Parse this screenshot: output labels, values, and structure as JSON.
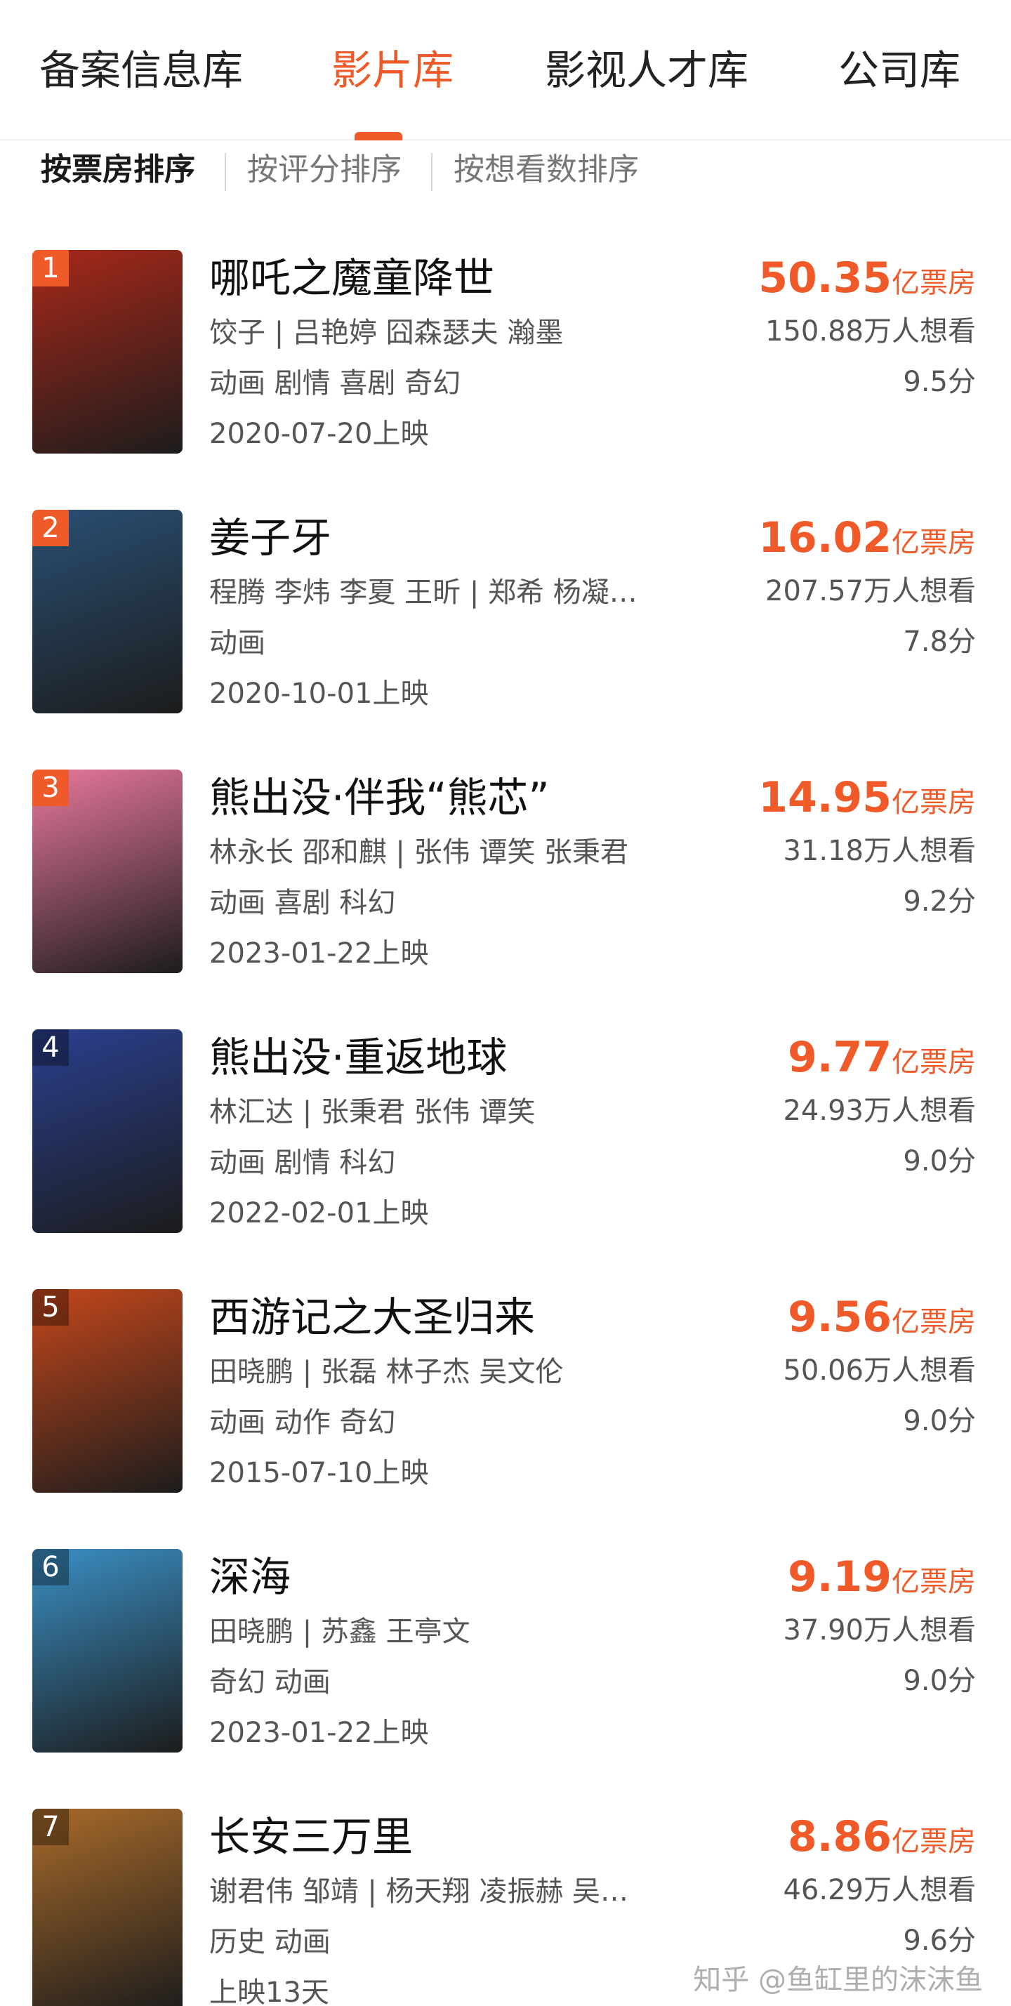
{
  "tabs": [
    "备案信息库",
    "影片库",
    "影视人才库",
    "公司库"
  ],
  "sort_options": [
    "按票房排序",
    "按评分排序",
    "按想看数排序"
  ],
  "movies": [
    {
      "rank": "1",
      "title": "哪吒之魔童降世",
      "cast": "饺子 | 吕艳婷 囧森瑟夫 瀚墨",
      "genres": "动画 剧情 喜剧 奇幻",
      "release": "2020-07-20上映",
      "box_office": "50.35",
      "box_office_unit": "亿票房",
      "want": "150.88万人想看",
      "score": "9.5分"
    },
    {
      "rank": "2",
      "title": "姜子牙",
      "cast": "程腾 李炜 李夏 王昕 | 郑希 杨凝…",
      "genres": "动画",
      "release": "2020-10-01上映",
      "box_office": "16.02",
      "box_office_unit": "亿票房",
      "want": "207.57万人想看",
      "score": "7.8分"
    },
    {
      "rank": "3",
      "title": "熊出没·伴我“熊芯”",
      "cast": "林永长 邵和麒 | 张伟 谭笑 张秉君",
      "genres": "动画 喜剧 科幻",
      "release": "2023-01-22上映",
      "box_office": "14.95",
      "box_office_unit": "亿票房",
      "want": "31.18万人想看",
      "score": "9.2分"
    },
    {
      "rank": "4",
      "title": "熊出没·重返地球",
      "cast": "林汇达 | 张秉君 张伟 谭笑",
      "genres": "动画 剧情 科幻",
      "release": "2022-02-01上映",
      "box_office": "9.77",
      "box_office_unit": "亿票房",
      "want": "24.93万人想看",
      "score": "9.0分"
    },
    {
      "rank": "5",
      "title": "西游记之大圣归来",
      "cast": "田晓鹏 | 张磊 林子杰 吴文伦",
      "genres": "动画 动作 奇幻",
      "release": "2015-07-10上映",
      "box_office": "9.56",
      "box_office_unit": "亿票房",
      "want": "50.06万人想看",
      "score": "9.0分"
    },
    {
      "rank": "6",
      "title": "深海",
      "cast": "田晓鹏 | 苏鑫 王亭文",
      "genres": "奇幻 动画",
      "release": "2023-01-22上映",
      "box_office": "9.19",
      "box_office_unit": "亿票房",
      "want": "37.90万人想看",
      "score": "9.0分"
    },
    {
      "rank": "7",
      "title": "长安三万里",
      "cast": "谢君伟 邹靖 | 杨天翔 凌振赫 吴…",
      "genres": "历史 动画",
      "release": "上映13天",
      "box_office": "8.86",
      "box_office_unit": "亿票房",
      "want": "46.29万人想看",
      "score": "9.6分"
    }
  ],
  "poster_colors": [
    "#a8281a",
    "#2a4f74",
    "#e8789c",
    "#2a3f8f",
    "#c4471c",
    "#3a8fc4",
    "#a86a2a"
  ],
  "accent_color": "#ef5a28",
  "watermark": "知乎 @鱼缸里的沫沫鱼"
}
